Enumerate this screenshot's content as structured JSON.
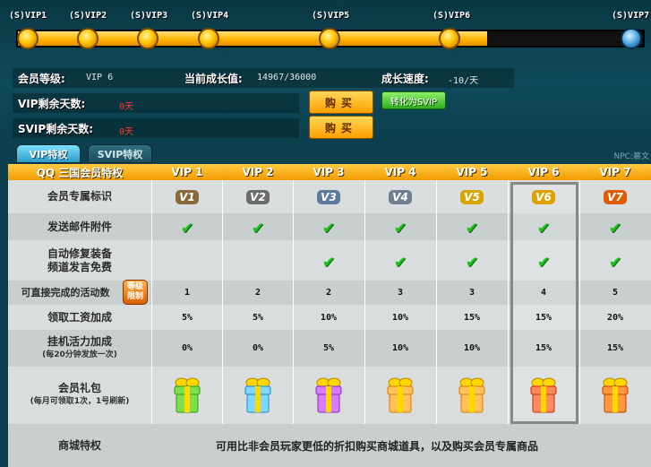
{
  "progress": {
    "ticks": [
      {
        "label": "(S)VIP1"
      },
      {
        "label": "(S)VIP2"
      },
      {
        "label": "(S)VIP3"
      },
      {
        "label": "(S)VIP4"
      },
      {
        "label": "(S)VIP5"
      },
      {
        "label": "(S)VIP6"
      },
      {
        "label": "(S)VIP7"
      }
    ],
    "filled_fraction": 0.75
  },
  "stats": {
    "member_level_label": "会员等级:",
    "member_level_value": "VIP 6",
    "growth_label": "当前成长值:",
    "growth_value": "14967/36000",
    "speed_label": "成长速度:",
    "speed_value": "-10/天",
    "vip_days_label": "VIP剩余天数:",
    "vip_days_value": "0天",
    "svip_days_label": "SVIP剩余天数:",
    "svip_days_value": "0天",
    "buy_label": "购买",
    "convert_label": "转化为SVIP"
  },
  "tabs": [
    {
      "label": "VIP特权"
    },
    {
      "label": "SVIP特权"
    }
  ],
  "npc_label": "NPC:慕文",
  "table": {
    "title": "QQ 三国会员特权",
    "columns": [
      "VIP 1",
      "VIP 2",
      "VIP 3",
      "VIP 4",
      "VIP 5",
      "VIP 6",
      "VIP 7"
    ],
    "highlight_column": 5,
    "rows": {
      "badge": {
        "label": "会员专属标识",
        "icons": [
          "V1",
          "V2",
          "V3",
          "V4",
          "V5",
          "V6",
          "V7"
        ]
      },
      "mail": {
        "label": "发送邮件附件",
        "checks": [
          true,
          true,
          true,
          true,
          true,
          true,
          true
        ]
      },
      "repair": {
        "label1": "自动修复装备",
        "label2": "频道发言免费",
        "checks": [
          false,
          false,
          true,
          true,
          true,
          true,
          true
        ]
      },
      "activities": {
        "label": "可直接完成的活动数",
        "badge": "等级限制",
        "values": [
          "1",
          "2",
          "2",
          "3",
          "3",
          "4",
          "5"
        ]
      },
      "salary": {
        "label": "领取工资加成",
        "values": [
          "5%",
          "5%",
          "10%",
          "10%",
          "15%",
          "15%",
          "20%"
        ]
      },
      "idle": {
        "label": "挂机活力加成",
        "sub": "(每20分钟发放一次)",
        "values": [
          "0%",
          "0%",
          "5%",
          "10%",
          "10%",
          "15%",
          "15%"
        ]
      },
      "gift": {
        "label": "会员礼包",
        "sub": "(每月可领取1次，1号刷新)",
        "icons": [
          "gift-green",
          "gift-blue",
          "gift-purple",
          "gift-orange",
          "gift-orange",
          "gift-red",
          "gift-red-gold"
        ]
      },
      "shop": {
        "label": "商城特权",
        "text": "可用比非会员玩家更低的折扣购买商城道具，以及购买会员专属商品"
      }
    }
  },
  "colors": {
    "gold": "#ffb400",
    "check_green": "#1fc11f",
    "header_orange": "#f29a00",
    "red_text": "#ff3a2a"
  }
}
